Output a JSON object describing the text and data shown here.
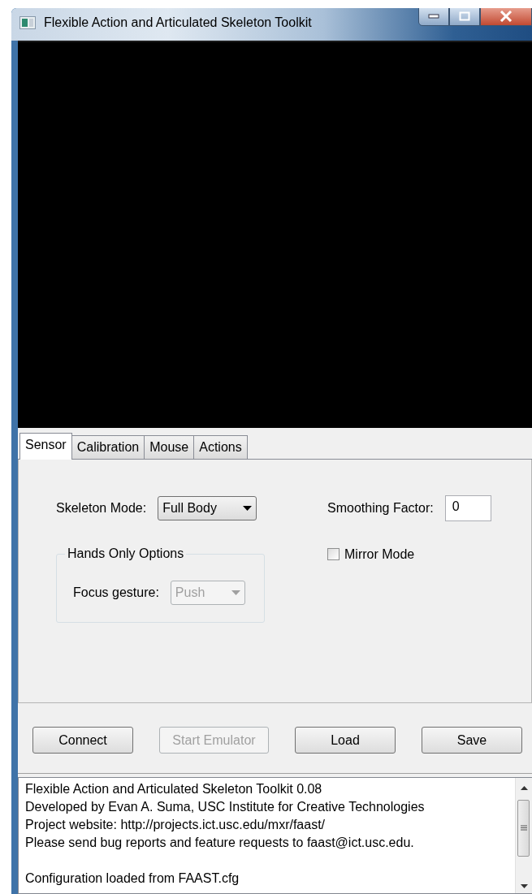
{
  "window": {
    "title": "Flexible Action and Articulated Skeleton Toolkit"
  },
  "tabs": [
    {
      "label": "Sensor",
      "selected": true
    },
    {
      "label": "Calibration",
      "selected": false
    },
    {
      "label": "Mouse",
      "selected": false
    },
    {
      "label": "Actions",
      "selected": false
    }
  ],
  "sensor": {
    "skeleton_mode": {
      "label": "Skeleton Mode:",
      "value": "Full Body"
    },
    "smoothing_factor": {
      "label": "Smoothing Factor:",
      "value": "0"
    },
    "mirror_mode": {
      "label": "Mirror Mode",
      "checked": false
    },
    "hands_only_options": {
      "title": "Hands Only Options",
      "focus_gesture": {
        "label": "Focus gesture:",
        "value": "Push",
        "disabled": true
      }
    }
  },
  "buttons": [
    {
      "label": "Connect",
      "disabled": false
    },
    {
      "label": "Start Emulator",
      "disabled": true
    },
    {
      "label": "Load",
      "disabled": false
    },
    {
      "label": "Save",
      "disabled": false
    }
  ],
  "log": {
    "blocks": [
      [
        "Flexible Action and Articulated Skeleton Toolkit 0.08",
        "Developed by Evan A. Suma, USC Institute for Creative Technologies",
        "Project website: http://projects.ict.usc.edu/mxr/faast/",
        "Please send bug reports and feature requests to faast@ict.usc.edu."
      ],
      [
        "Configuration loaded from FAAST.cfg"
      ]
    ]
  }
}
